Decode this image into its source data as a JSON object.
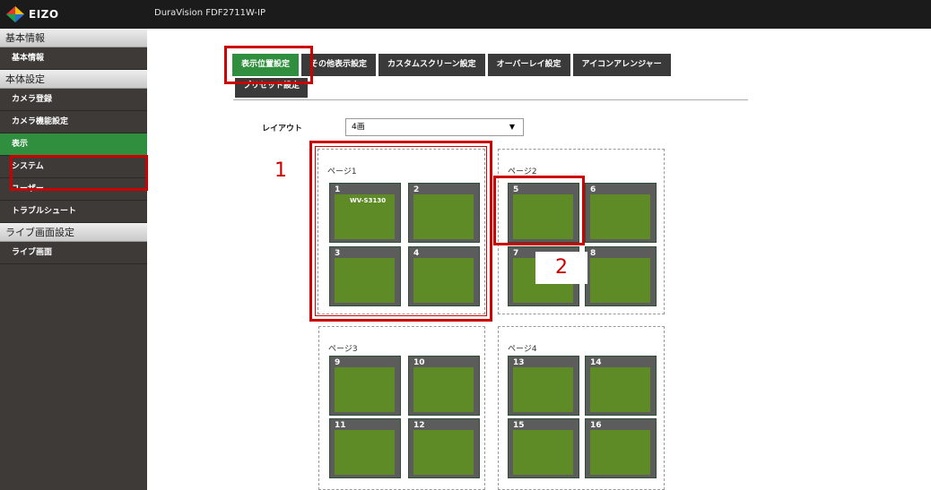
{
  "header": {
    "logo_text": "EIZO",
    "product_name": "DuraVision FDF2711W-IP"
  },
  "sidebar": {
    "sections": [
      {
        "title": "基本情報",
        "items": [
          "基本情報"
        ]
      },
      {
        "title": "本体設定",
        "items": [
          "カメラ登録",
          "カメラ機能設定",
          "表示",
          "システム",
          "ユーザー",
          "トラブルシュート"
        ]
      },
      {
        "title": "ライブ画面設定",
        "items": [
          "ライブ画面"
        ]
      }
    ],
    "active_item": "表示"
  },
  "tabs": [
    "表示位置設定",
    "その他表示設定",
    "カスタムスクリーン設定",
    "オーバーレイ設定",
    "アイコンアレンジャー",
    "プリセット設定"
  ],
  "layout": {
    "label": "レイアウト",
    "selected": "4画"
  },
  "pages": [
    {
      "title": "ページ1",
      "cells": [
        {
          "num": "1",
          "camera": "WV-S3130"
        },
        {
          "num": "2",
          "camera": ""
        },
        {
          "num": "3",
          "camera": ""
        },
        {
          "num": "4",
          "camera": ""
        }
      ]
    },
    {
      "title": "ページ2",
      "cells": [
        {
          "num": "5",
          "camera": ""
        },
        {
          "num": "6",
          "camera": ""
        },
        {
          "num": "7",
          "camera": ""
        },
        {
          "num": "8",
          "camera": ""
        }
      ]
    },
    {
      "title": "ページ3",
      "cells": [
        {
          "num": "9",
          "camera": ""
        },
        {
          "num": "10",
          "camera": ""
        },
        {
          "num": "11",
          "camera": ""
        },
        {
          "num": "12",
          "camera": ""
        }
      ]
    },
    {
      "title": "ページ4",
      "cells": [
        {
          "num": "13",
          "camera": ""
        },
        {
          "num": "14",
          "camera": ""
        },
        {
          "num": "15",
          "camera": ""
        },
        {
          "num": "16",
          "camera": ""
        }
      ]
    }
  ],
  "callouts": [
    "1",
    "2"
  ],
  "colors": {
    "accent_green": "#2f8f3e",
    "highlight_red": "#cc0000",
    "cell_green": "#5f8b27"
  }
}
